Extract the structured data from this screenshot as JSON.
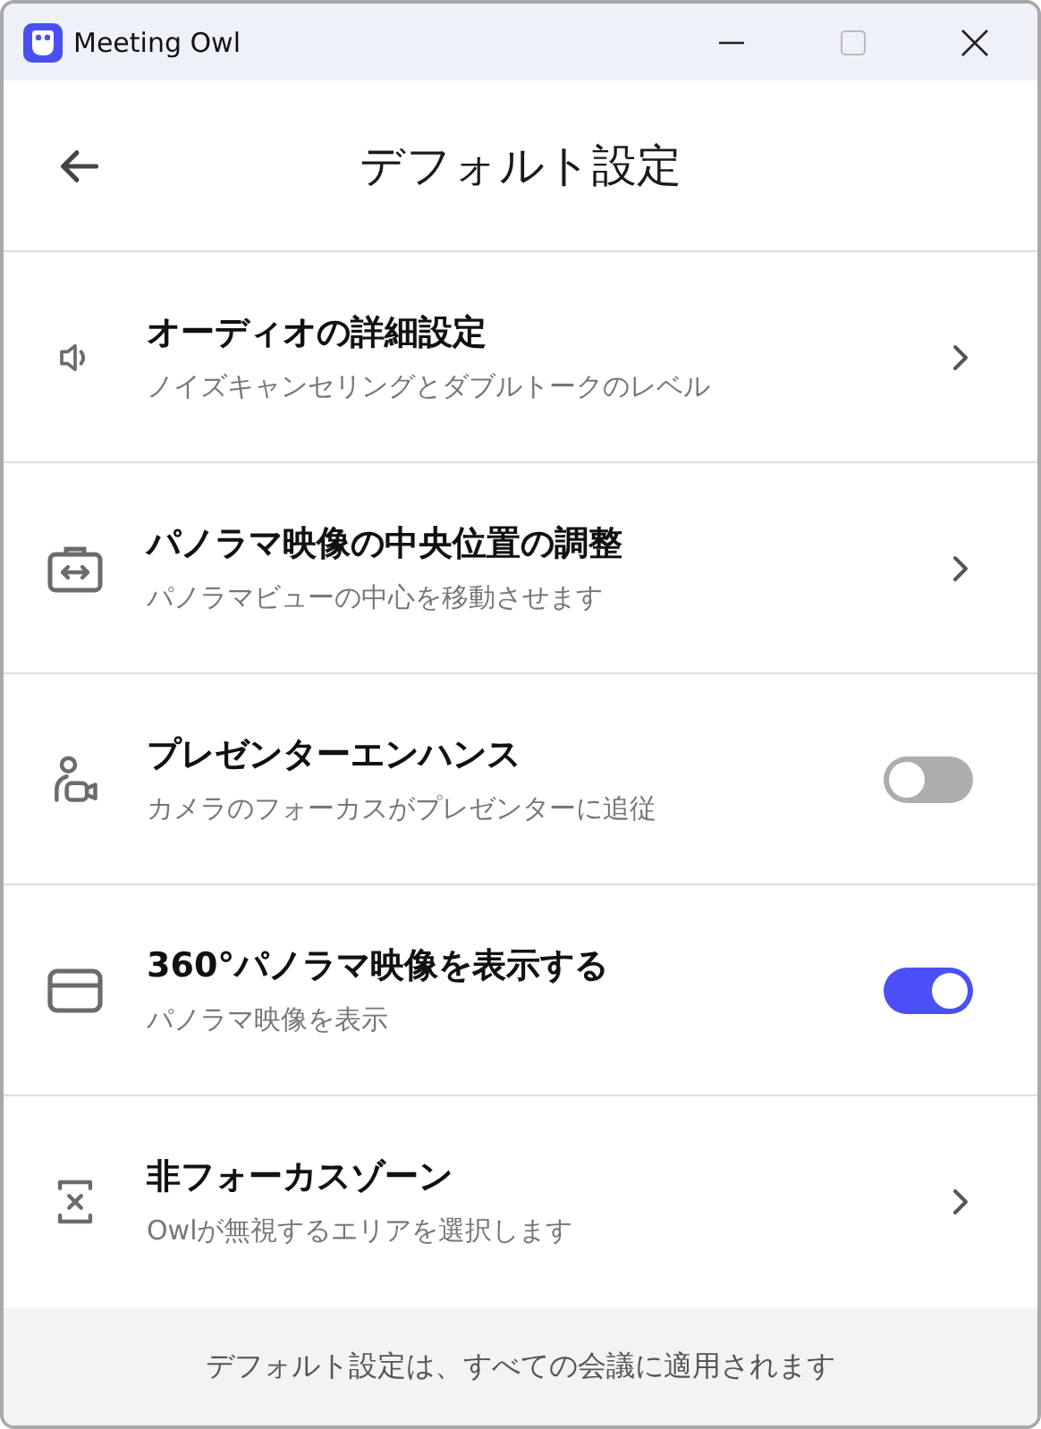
{
  "window": {
    "title": "Meeting Owl"
  },
  "header": {
    "title": "デフォルト設定"
  },
  "settings": [
    {
      "kind": "link",
      "title": "オーディオの詳細設定",
      "subtitle": "ノイズキャンセリングとダブルトークのレベル"
    },
    {
      "kind": "link",
      "title": "パノラマ映像の中央位置の調整",
      "subtitle": "パノラマビューの中心を移動させます"
    },
    {
      "kind": "toggle",
      "title": "プレゼンターエンハンス",
      "subtitle": "カメラのフォーカスがプレゼンターに追従",
      "on": false
    },
    {
      "kind": "toggle",
      "title": "360°パノラマ映像を表示する",
      "subtitle": "パノラマ映像を表示",
      "on": true
    },
    {
      "kind": "link",
      "title": "非フォーカスゾーン",
      "subtitle": "Owlが無視するエリアを選択します"
    }
  ],
  "footer": "デフォルト設定は、すべての会議に適用されます"
}
